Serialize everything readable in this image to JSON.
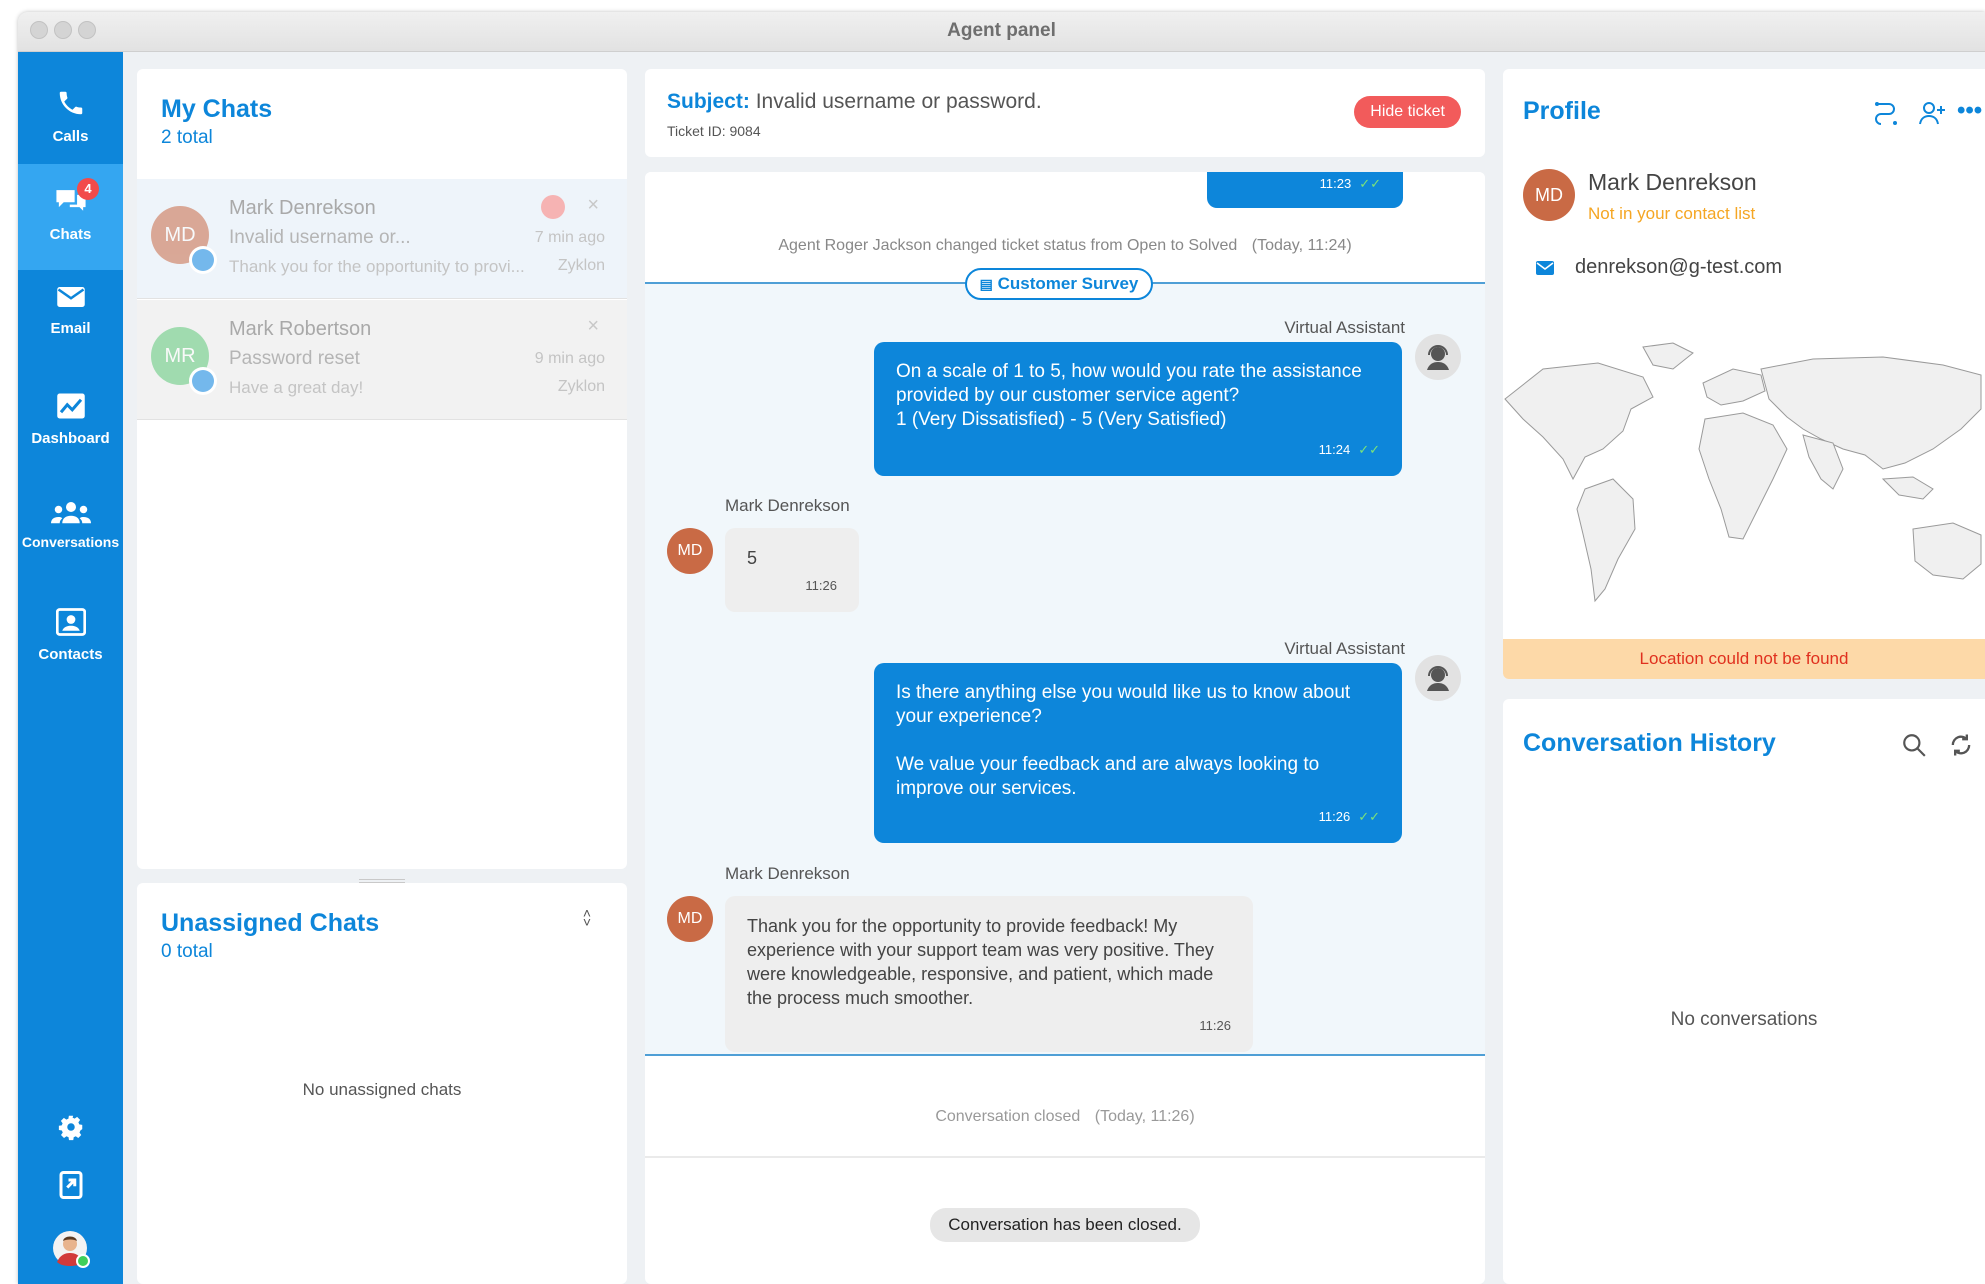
{
  "window": {
    "title": "Agent panel"
  },
  "nav": {
    "items": [
      {
        "label": "Calls",
        "icon": "phone-icon"
      },
      {
        "label": "Chats",
        "icon": "chat-bubbles-icon",
        "badge": "4",
        "active": true
      },
      {
        "label": "Email",
        "icon": "envelope-icon"
      },
      {
        "label": "Dashboard",
        "icon": "chart-icon"
      },
      {
        "label": "Conversations",
        "icon": "people-group-icon"
      },
      {
        "label": "Contacts",
        "icon": "contact-card-icon"
      }
    ],
    "bottom_icons": [
      "gear-icon",
      "logout-icon",
      "user-avatar"
    ]
  },
  "my_chats": {
    "title": "My Chats",
    "total": "2 total",
    "items": [
      {
        "initials": "MD",
        "name": "Mark Denrekson",
        "subject": "Invalid username or...",
        "last": "Thank you for the opportunity to provi...",
        "time": "7 min ago",
        "source": "Zyklon",
        "avatar_color": "#c96a45"
      },
      {
        "initials": "MR",
        "name": "Mark Robertson",
        "subject": "Password reset",
        "last": "Have a great day!",
        "time": "9 min ago",
        "source": "Zyklon",
        "avatar_color": "#5ec97a"
      }
    ]
  },
  "unassigned": {
    "title": "Unassigned Chats",
    "total": "0 total",
    "empty": "No unassigned chats"
  },
  "ticket": {
    "subject_label": "Subject:",
    "subject": "Invalid username or password.",
    "ticket_id": "Ticket ID: 9084",
    "hide_button": "Hide ticket"
  },
  "conversation": {
    "top_time": "11:23",
    "status_event": "Agent Roger Jackson changed ticket status from Open to Solved",
    "status_event_time": "(Today, 11:24)",
    "survey_label": "Customer Survey",
    "messages": [
      {
        "from": "Virtual Assistant",
        "text": "On a scale of 1 to 5, how would you rate the assistance provided by our customer service agent?\n1 (Very Dissatisfied) - 5 (Very Satisfied)",
        "time": "11:24"
      },
      {
        "from": "Mark Denrekson",
        "initials": "MD",
        "text": "5",
        "time": "11:26"
      },
      {
        "from": "Virtual Assistant",
        "text": "Is there anything else you would like us to know about your experience?\n\nWe value your feedback and are always looking to improve our services.",
        "time": "11:26"
      },
      {
        "from": "Mark Denrekson",
        "initials": "MD",
        "text": "Thank you for the opportunity to provide feedback! My experience with your support team was very positive. They were knowledgeable, responsive, and patient, which made the process much smoother.",
        "time": "11:26"
      }
    ],
    "closed_event": "Conversation closed",
    "closed_event_time": "(Today, 11:26)",
    "closed_pill": "Conversation has been closed."
  },
  "profile": {
    "title": "Profile",
    "initials": "MD",
    "name": "Mark Denrekson",
    "contact_status": "Not in your contact list",
    "email": "denrekson@g-test.com",
    "location_error": "Location could not be found"
  },
  "history": {
    "title": "Conversation History",
    "empty": "No conversations"
  },
  "colors": {
    "accent": "#0d86da",
    "nav_active": "#34a6f1",
    "hide_button": "#f25b5b",
    "contact_status": "#f5a623",
    "location_banner": "#fdd9a8",
    "location_text": "#e0301e"
  }
}
